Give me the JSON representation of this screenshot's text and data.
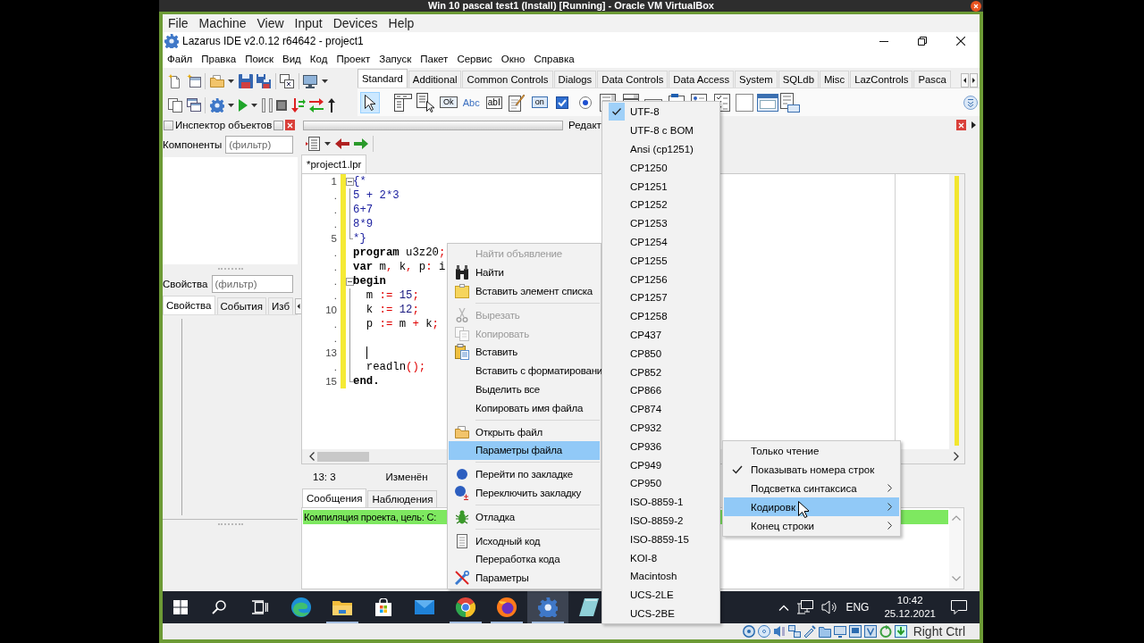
{
  "vm_window": {
    "title": "Win 10 pascal test1 (Install) [Running] - Oracle VM VirtualBox",
    "menu": [
      "File",
      "Machine",
      "View",
      "Input",
      "Devices",
      "Help"
    ],
    "host_key": "Right Ctrl"
  },
  "ide_window": {
    "title": "Lazarus IDE v2.0.12 r64642 - project1",
    "menu": [
      "Файл",
      "Правка",
      "Поиск",
      "Вид",
      "Код",
      "Проект",
      "Запуск",
      "Пакет",
      "Сервис",
      "Окно",
      "Справка"
    ]
  },
  "component_palette": {
    "tabs": [
      {
        "label": "Standard",
        "selected": true
      },
      {
        "label": "Additional",
        "selected": false
      },
      {
        "label": "Common Controls",
        "selected": false
      },
      {
        "label": "Dialogs",
        "selected": false
      },
      {
        "label": "Data Controls",
        "selected": false
      },
      {
        "label": "Data Access",
        "selected": false
      },
      {
        "label": "System",
        "selected": false
      },
      {
        "label": "SQLdb",
        "selected": false
      },
      {
        "label": "Misc",
        "selected": false
      },
      {
        "label": "LazControls",
        "selected": false
      },
      {
        "label": "Pasca",
        "selected": false
      }
    ],
    "tools": [
      {
        "kind": "pointer",
        "selected": true
      },
      {
        "kind": "main_menu",
        "selected": false
      },
      {
        "kind": "popup_menu",
        "selected": false
      },
      {
        "kind": "button",
        "label": "Ok",
        "selected": false
      },
      {
        "kind": "label",
        "label": "Abc",
        "selected": false
      },
      {
        "kind": "edit",
        "label": "abI",
        "selected": false
      },
      {
        "kind": "memo",
        "selected": false
      },
      {
        "kind": "toggle",
        "label": "on",
        "selected": false
      },
      {
        "kind": "checkbox",
        "selected": false
      },
      {
        "kind": "radio",
        "selected": false
      },
      {
        "kind": "listbox",
        "selected": false
      },
      {
        "kind": "combobox",
        "selected": false
      },
      {
        "kind": "scrollbar",
        "selected": false
      },
      {
        "kind": "groupbox",
        "selected": false
      },
      {
        "kind": "radiogroup",
        "selected": false
      },
      {
        "kind": "checkgroup",
        "selected": false
      },
      {
        "kind": "panel",
        "selected": false
      },
      {
        "kind": "frame",
        "selected": false
      },
      {
        "kind": "actionlist",
        "selected": false
      }
    ]
  },
  "object_inspector": {
    "title": "Инспектор объектов",
    "components": {
      "label": "Компоненты",
      "filter": {
        "placeholder": "(фильтр)"
      }
    },
    "properties": {
      "label": "Свойства",
      "filter": {
        "placeholder": "(фильтр)"
      }
    },
    "tabs": [
      {
        "label": "Свойства",
        "selected": true
      },
      {
        "label": "События",
        "selected": false
      },
      {
        "label": "Изб",
        "selected": false
      }
    ]
  },
  "source_editor": {
    "title": "Редакт",
    "tabs": [
      {
        "label": "*project1.lpr",
        "selected": true
      }
    ],
    "lines": [
      {
        "number": "1",
        "modified": true,
        "kind": "open",
        "tokens": [
          {
            "text": "{*",
            "kind": "comment"
          }
        ]
      },
      {
        "number": ".",
        "modified": true,
        "kind": "inner",
        "tokens": [
          {
            "text": "5 + 2*3",
            "kind": "comment"
          }
        ]
      },
      {
        "number": ".",
        "modified": true,
        "kind": "inner",
        "tokens": [
          {
            "text": "6+7",
            "kind": "comment"
          }
        ]
      },
      {
        "number": ".",
        "modified": true,
        "kind": "inner",
        "tokens": [
          {
            "text": "8*9",
            "kind": "comment"
          }
        ]
      },
      {
        "number": "5",
        "modified": true,
        "kind": "end",
        "tokens": [
          {
            "text": "*}",
            "kind": "comment"
          }
        ]
      },
      {
        "number": ".",
        "modified": true,
        "kind": "plain",
        "tokens": [
          {
            "text": "program",
            "kind": "keyword"
          },
          {
            "text": " u3z20",
            "kind": "identifier"
          },
          {
            "text": ";",
            "kind": "symbol"
          }
        ]
      },
      {
        "number": ".",
        "modified": true,
        "kind": "plain",
        "tokens": [
          {
            "text": "var",
            "kind": "keyword"
          },
          {
            "text": " m",
            "kind": "identifier"
          },
          {
            "text": ",",
            "kind": "symbol"
          },
          {
            "text": " k",
            "kind": "identifier"
          },
          {
            "text": ",",
            "kind": "symbol"
          },
          {
            "text": " p",
            "kind": "identifier"
          },
          {
            "text": ":",
            "kind": "symbol"
          },
          {
            "text": " i",
            "kind": "identifier"
          }
        ]
      },
      {
        "number": ".",
        "modified": true,
        "kind": "open",
        "tokens": [
          {
            "text": "begin",
            "kind": "keyword"
          }
        ]
      },
      {
        "number": ".",
        "modified": true,
        "kind": "inner",
        "tokens": [
          {
            "text": "  m ",
            "kind": "identifier"
          },
          {
            "text": ":=",
            "kind": "symbol"
          },
          {
            "text": " 15",
            "kind": "number"
          },
          {
            "text": ";",
            "kind": "symbol"
          }
        ]
      },
      {
        "number": "10",
        "modified": true,
        "kind": "inner",
        "tokens": [
          {
            "text": "  k ",
            "kind": "identifier"
          },
          {
            "text": ":=",
            "kind": "symbol"
          },
          {
            "text": " 12",
            "kind": "number"
          },
          {
            "text": ";",
            "kind": "symbol"
          }
        ]
      },
      {
        "number": ".",
        "modified": true,
        "kind": "inner",
        "tokens": [
          {
            "text": "  p ",
            "kind": "identifier"
          },
          {
            "text": ":=",
            "kind": "symbol"
          },
          {
            "text": " m ",
            "kind": "identifier"
          },
          {
            "text": "+",
            "kind": "symbol"
          },
          {
            "text": " k",
            "kind": "identifier"
          },
          {
            "text": ";",
            "kind": "symbol"
          }
        ]
      },
      {
        "number": ".",
        "modified": true,
        "kind": "inner"
      },
      {
        "number": "13",
        "modified": true,
        "kind": "inner",
        "caret": true
      },
      {
        "number": ".",
        "modified": true,
        "kind": "inner",
        "tokens": [
          {
            "text": "  readln",
            "kind": "identifier"
          },
          {
            "text": "();",
            "kind": "symbol"
          }
        ]
      },
      {
        "number": "15",
        "modified": true,
        "kind": "end",
        "tokens": [
          {
            "text": "end.",
            "kind": "keyword"
          }
        ]
      }
    ],
    "status": {
      "position": "13: 3",
      "state": "Изменён"
    }
  },
  "messages": {
    "tabs": [
      {
        "label": "Сообщения",
        "selected": true
      },
      {
        "label": "Наблюдения",
        "selected": false
      }
    ],
    "lines": [
      {
        "text": "Компиляция проекта, цель: C:",
        "kind": "success"
      }
    ]
  },
  "context_menu": {
    "groups": [
      [
        {
          "label": "Найти объявление",
          "disabled": true,
          "selected": false
        },
        {
          "label": "Найти",
          "disabled": false,
          "selected": false
        },
        {
          "label": "Вставить элемент списка",
          "disabled": false,
          "selected": false
        }
      ],
      [
        {
          "label": "Вырезать",
          "disabled": true,
          "selected": false
        },
        {
          "label": "Копировать",
          "disabled": true,
          "selected": false
        },
        {
          "label": "Вставить",
          "disabled": false,
          "selected": false
        },
        {
          "label": "Вставить с форматировани",
          "disabled": false,
          "selected": false
        },
        {
          "label": "Выделить все",
          "disabled": false,
          "selected": false
        },
        {
          "label": "Копировать имя файла",
          "disabled": false,
          "selected": false
        }
      ],
      [
        {
          "label": "Открыть файл",
          "disabled": false,
          "selected": false
        },
        {
          "label": "Параметры файла",
          "disabled": false,
          "selected": true
        }
      ],
      [
        {
          "label": "Перейти по закладке",
          "disabled": false,
          "selected": false
        },
        {
          "label": "Переключить закладку",
          "disabled": false,
          "selected": false
        }
      ],
      [
        {
          "label": "Отладка",
          "disabled": false,
          "selected": false
        }
      ],
      [
        {
          "label": "Исходный код",
          "disabled": false,
          "selected": false
        },
        {
          "label": "Переработка кода",
          "disabled": false,
          "selected": false
        },
        {
          "label": "Параметры",
          "disabled": false,
          "selected": false
        }
      ]
    ]
  },
  "file_submenu": {
    "items": [
      {
        "label": "Только чтение",
        "checked": false,
        "selected": false,
        "submenu": false
      },
      {
        "label": "Показывать номера строк",
        "checked": true,
        "selected": false,
        "submenu": false
      },
      {
        "label": "Подсветка синтаксиса",
        "checked": false,
        "selected": false,
        "submenu": true
      },
      {
        "label": "Кодировк",
        "checked": false,
        "selected": true,
        "submenu": true
      },
      {
        "label": "Конец строки",
        "checked": false,
        "selected": false,
        "submenu": true
      }
    ]
  },
  "encoding_submenu": {
    "items": [
      {
        "label": "UTF-8",
        "checked": true
      },
      {
        "label": "UTF-8 с BOM",
        "checked": false
      },
      {
        "label": "Ansi (cp1251)",
        "checked": false
      },
      {
        "label": "CP1250",
        "checked": false
      },
      {
        "label": "CP1251",
        "checked": false
      },
      {
        "label": "CP1252",
        "checked": false
      },
      {
        "label": "CP1253",
        "checked": false
      },
      {
        "label": "CP1254",
        "checked": false
      },
      {
        "label": "CP1255",
        "checked": false
      },
      {
        "label": "CP1256",
        "checked": false
      },
      {
        "label": "CP1257",
        "checked": false
      },
      {
        "label": "CP1258",
        "checked": false
      },
      {
        "label": "CP437",
        "checked": false
      },
      {
        "label": "CP850",
        "checked": false
      },
      {
        "label": "CP852",
        "checked": false
      },
      {
        "label": "CP866",
        "checked": false
      },
      {
        "label": "CP874",
        "checked": false
      },
      {
        "label": "CP932",
        "checked": false
      },
      {
        "label": "CP936",
        "checked": false
      },
      {
        "label": "CP949",
        "checked": false
      },
      {
        "label": "CP950",
        "checked": false
      },
      {
        "label": "ISO-8859-1",
        "checked": false
      },
      {
        "label": "ISO-8859-2",
        "checked": false
      },
      {
        "label": "ISO-8859-15",
        "checked": false
      },
      {
        "label": "KOI-8",
        "checked": false
      },
      {
        "label": "Macintosh",
        "checked": false
      },
      {
        "label": "UCS-2LE",
        "checked": false
      },
      {
        "label": "UCS-2BE",
        "checked": false
      }
    ]
  },
  "taskbar": {
    "apps": [
      {
        "kind": "edge",
        "running": false,
        "selected": false
      },
      {
        "kind": "explorer",
        "running": true,
        "selected": false
      },
      {
        "kind": "store",
        "running": false,
        "selected": false
      },
      {
        "kind": "mail",
        "running": false,
        "selected": false
      },
      {
        "kind": "chrome",
        "running": true,
        "selected": false
      },
      {
        "kind": "firefox",
        "running": true,
        "selected": false
      },
      {
        "kind": "lazarus",
        "running": true,
        "selected": true
      },
      {
        "kind": "tablet",
        "running": false,
        "selected": false
      }
    ],
    "tray": {
      "language": "ENG",
      "time": "10:42",
      "date": "25.12.2021"
    }
  }
}
